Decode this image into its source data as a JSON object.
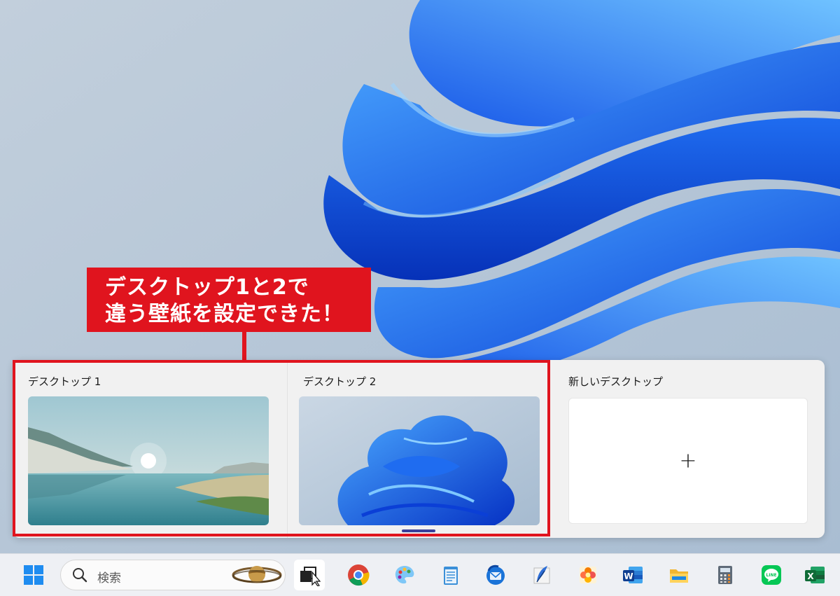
{
  "callout": {
    "line1": "デスクトップ1と2で",
    "line2": "違う壁紙を設定できた！",
    "color": "#e0141e"
  },
  "task_view": {
    "desktops": [
      {
        "label": "デスクトップ 1",
        "wallpaper": "lake-landscape"
      },
      {
        "label": "デスクトップ 2",
        "wallpaper": "blue-bloom"
      }
    ],
    "new_desktop": {
      "label": "新しいデスクトップ",
      "plus": "+"
    }
  },
  "taskbar": {
    "search_placeholder": "検索",
    "icons": [
      "start-icon",
      "search-icon",
      "task-view-icon",
      "chrome-icon",
      "paint-icon",
      "notepad-icon",
      "thunderbird-icon",
      "feather-icon",
      "flower-app-icon",
      "word-icon",
      "file-explorer-icon",
      "calculator-icon",
      "line-icon",
      "excel-icon"
    ]
  }
}
